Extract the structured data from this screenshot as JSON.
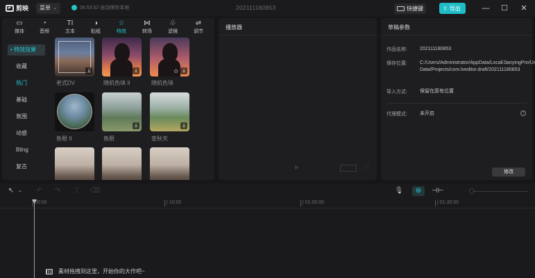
{
  "app": {
    "name": "剪映",
    "menu_label": "菜单",
    "autosave_text": "06:53:52 自动保存本地",
    "draft_title": "202111180853"
  },
  "top_actions": {
    "shortcut_label": "快捷键",
    "export_label": "导出"
  },
  "tabs": [
    {
      "label": "媒体",
      "icon": "media-icon"
    },
    {
      "label": "音频",
      "icon": "audio-icon"
    },
    {
      "label": "文本",
      "icon": "text-icon"
    },
    {
      "label": "贴纸",
      "icon": "sticker-icon"
    },
    {
      "label": "特效",
      "icon": "effects-icon",
      "active": true
    },
    {
      "label": "转场",
      "icon": "transition-icon"
    },
    {
      "label": "滤镜",
      "icon": "filter-icon"
    },
    {
      "label": "调节",
      "icon": "adjust-icon"
    }
  ],
  "effect_categories": {
    "header": "• 特效效果",
    "items": [
      "收藏",
      "热门",
      "基础",
      "氛围",
      "动感",
      "Bling",
      "复古"
    ],
    "active_index": 1
  },
  "effects": [
    {
      "label": "老式DV",
      "style": "cam"
    },
    {
      "label": "随机色块 II",
      "style": "girl"
    },
    {
      "label": "随机色块",
      "style": "girl2"
    },
    {
      "label": "鱼眼 II",
      "style": "globe"
    },
    {
      "label": "鱼眼",
      "style": "forest"
    },
    {
      "label": "变秋天",
      "style": "forest2"
    },
    {
      "label": "",
      "style": "mtn"
    },
    {
      "label": "",
      "style": "mtn"
    },
    {
      "label": "",
      "style": "mtn"
    }
  ],
  "player": {
    "title": "播放器"
  },
  "draft_params": {
    "title": "草稿参数",
    "rows": [
      {
        "label": "作品名称:",
        "value": "202111180853"
      },
      {
        "label": "保存位置:",
        "value": "C:/Users/Administrator/AppData/Local/JianyingPro/User Data/Projects/com.lveditor.draft/202111180853"
      },
      {
        "label": "导入方式:",
        "value": "保留在原有位置"
      },
      {
        "label": "代理模式:",
        "value": "未开启"
      }
    ],
    "edit_label": "修改"
  },
  "timeline": {
    "ticks": [
      "00:00",
      "| 10:00",
      "| 01:00:00",
      "| 01:30:00"
    ],
    "drop_hint": "素材拖拽到这里，开始你的大作吧~"
  },
  "colors": {
    "accent": "#22c9d4",
    "background": "#161618",
    "panel": "#1e1e21"
  }
}
